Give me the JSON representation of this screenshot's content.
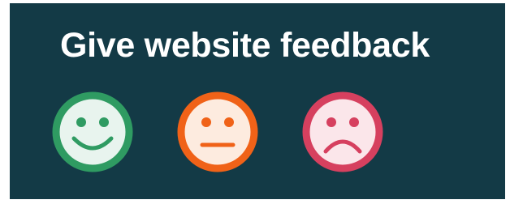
{
  "feedback": {
    "title": "Give website feedback",
    "options": [
      {
        "id": "happy",
        "icon": "happy-face-icon",
        "ring": "#2f9b62",
        "fill": "#e8f4ee"
      },
      {
        "id": "neutral",
        "icon": "neutral-face-icon",
        "ring": "#f06218",
        "fill": "#fdebdf"
      },
      {
        "id": "sad",
        "icon": "sad-face-icon",
        "ring": "#d6405f",
        "fill": "#fbe6ea"
      }
    ]
  }
}
